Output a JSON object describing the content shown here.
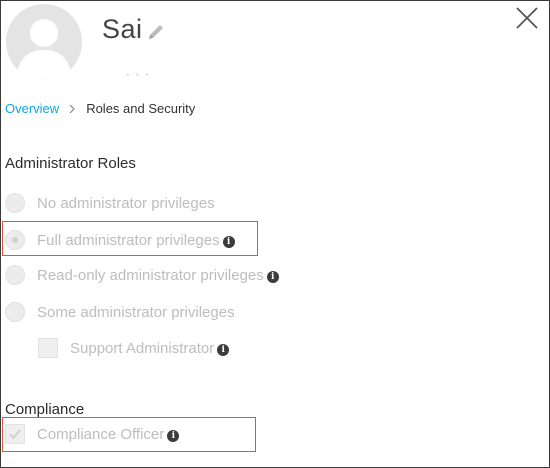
{
  "profile": {
    "name": "Sai",
    "edit_icon": "pencil-icon",
    "avatar_icon": "user-silhouette-icon",
    "close_icon": "close-icon"
  },
  "breadcrumb": {
    "overview": "Overview",
    "current": "Roles and Security"
  },
  "admin_roles": {
    "title": "Administrator Roles",
    "options": [
      {
        "label": "No administrator privileges",
        "selected": false,
        "info": false
      },
      {
        "label": "Full administrator privileges",
        "selected": true,
        "info": true
      },
      {
        "label": "Read-only administrator privileges",
        "selected": false,
        "info": true
      },
      {
        "label": "Some administrator privileges",
        "selected": false,
        "info": false
      }
    ],
    "sub_options": [
      {
        "label": "Support Administrator",
        "checked": false,
        "info": true
      }
    ]
  },
  "compliance": {
    "title": "Compliance",
    "options": [
      {
        "label": "Compliance Officer",
        "checked": true,
        "info": true
      }
    ]
  },
  "colors": {
    "link": "#16a3d6",
    "highlight": "#e0543c",
    "disabled_text": "#bdbdbd"
  }
}
